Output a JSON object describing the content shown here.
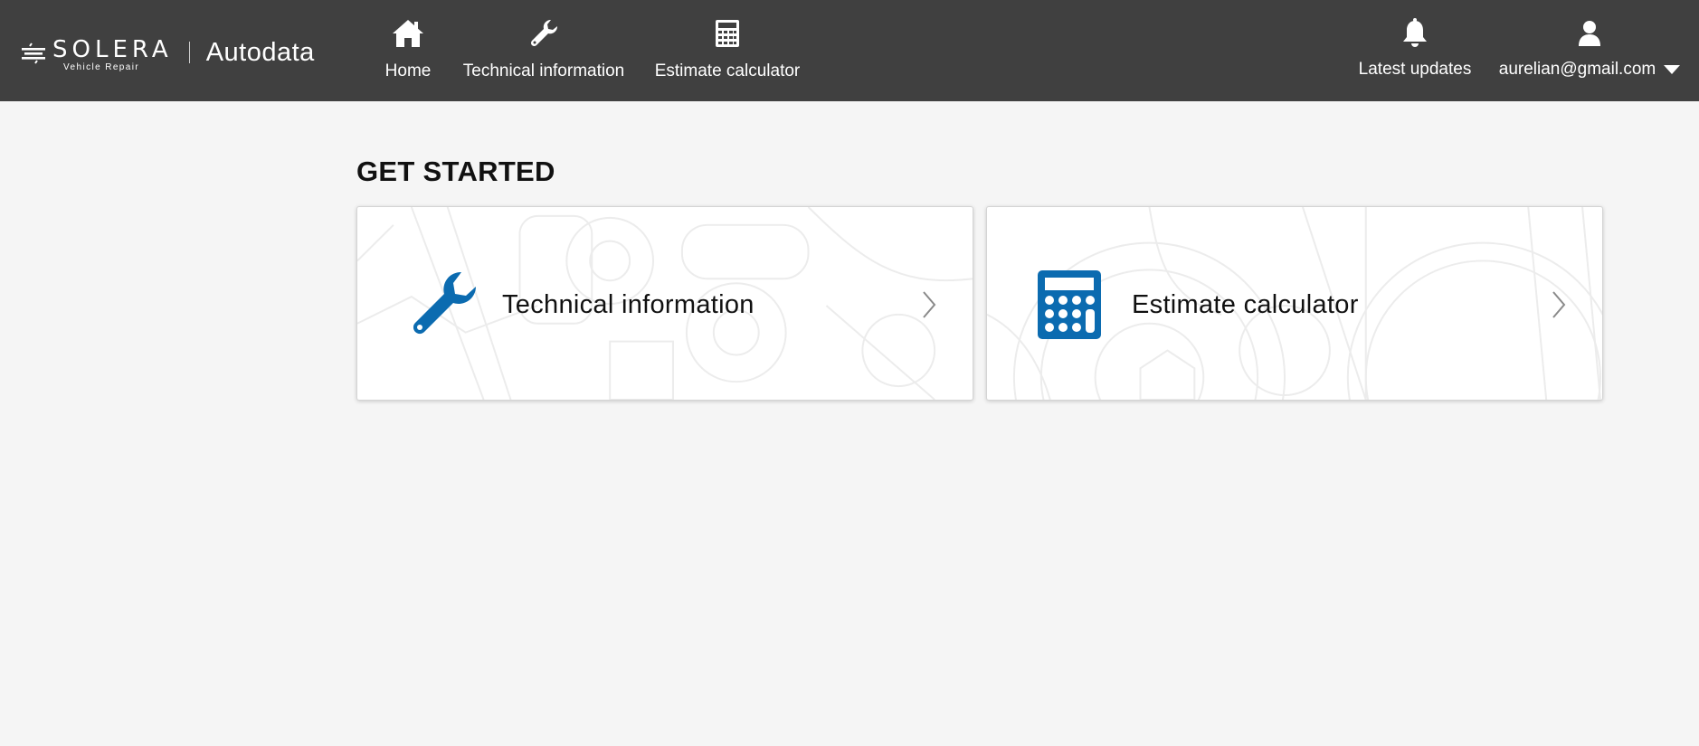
{
  "logo": {
    "brand": "SOLERA",
    "sub": "Vehicle Repair",
    "product": "Autodata"
  },
  "nav": {
    "home": "Home",
    "technical": "Technical information",
    "estimate": "Estimate calculator",
    "updates": "Latest updates",
    "user": "aurelian@gmail.com"
  },
  "icons": {
    "home": "home-icon",
    "technical": "wrench-icon",
    "estimate": "calculator-icon",
    "updates": "bell-icon",
    "user": "user-icon",
    "dropdown": "caret-down-icon",
    "chevron": "chevron-right-icon"
  },
  "main": {
    "title": "GET STARTED",
    "cards": [
      {
        "label": "Technical information"
      },
      {
        "label": "Estimate calculator"
      }
    ]
  },
  "colors": {
    "header_bg": "#404040",
    "accent_blue": "#0b6bb0",
    "page_bg": "#f5f5f5"
  }
}
